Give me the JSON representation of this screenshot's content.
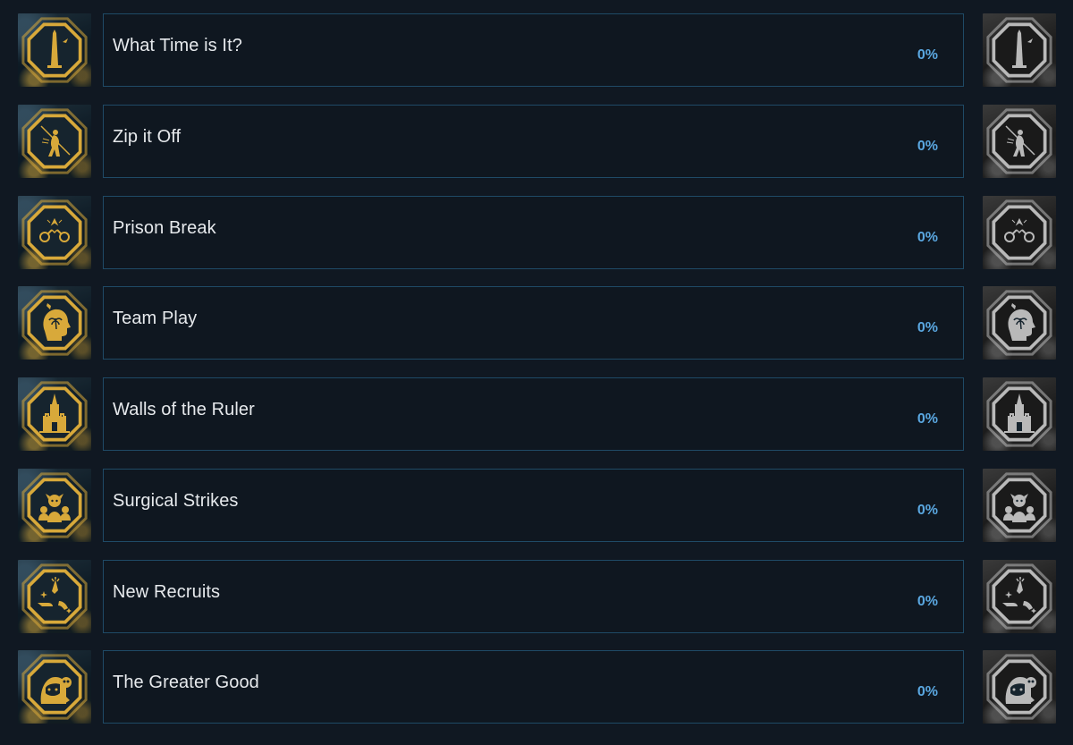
{
  "achievements": [
    {
      "name": "What Time is It?",
      "percent": "0%",
      "icon": "obelisk-icon"
    },
    {
      "name": "Zip it Off",
      "percent": "0%",
      "icon": "zipline-icon"
    },
    {
      "name": "Prison Break",
      "percent": "0%",
      "icon": "broken-shackles-icon"
    },
    {
      "name": "Team Play",
      "percent": "0%",
      "icon": "head-palm-icon"
    },
    {
      "name": "Walls of the Ruler",
      "percent": "0%",
      "icon": "fortress-tower-icon"
    },
    {
      "name": "Surgical Strikes",
      "percent": "0%",
      "icon": "masked-targets-icon"
    },
    {
      "name": "New Recruits",
      "percent": "0%",
      "icon": "hands-recruit-icon"
    },
    {
      "name": "The Greater Good",
      "percent": "0%",
      "icon": "recruit-skull-icon"
    }
  ],
  "colors": {
    "background": "#101822",
    "bar_border": "#1f4a66",
    "title_text": "#e6e9ec",
    "percent_text": "#5aa7e0",
    "badge_gold": "#d8a93a",
    "badge_grey": "#b9b9b9"
  }
}
